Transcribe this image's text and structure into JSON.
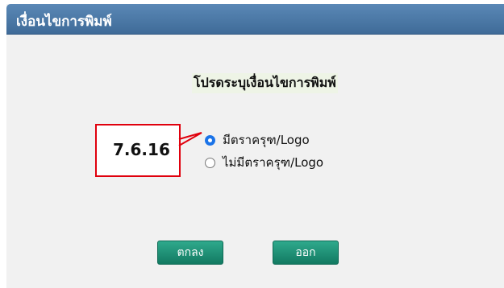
{
  "dialog": {
    "title": "เงื่อนไขการพิมพ์",
    "prompt": "โปรดระบุเงื่อนไขการพิมพ์"
  },
  "annotation": {
    "label": "7.6.16",
    "border_color": "#e0000d"
  },
  "options": [
    {
      "label": "มีตราครุฑ/Logo",
      "selected": true
    },
    {
      "label": "ไม่มีตราครุฑ/Logo",
      "selected": false
    }
  ],
  "buttons": {
    "ok_label": "ตกลง",
    "exit_label": "ออก"
  },
  "colors": {
    "titlebar": "#4a78a6",
    "button": "#1f8f74",
    "radio_selected": "#1a73e8"
  }
}
